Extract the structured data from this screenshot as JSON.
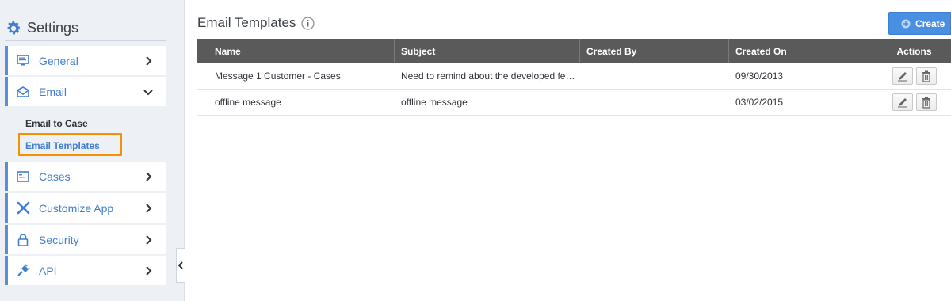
{
  "sidebar": {
    "title": "Settings",
    "items": [
      {
        "label": "General"
      },
      {
        "label": "Email"
      },
      {
        "label": "Cases"
      },
      {
        "label": "Customize App"
      },
      {
        "label": "Security"
      },
      {
        "label": "API"
      }
    ],
    "email_subitems": [
      {
        "label": "Email to Case"
      },
      {
        "label": "Email Templates"
      }
    ]
  },
  "main": {
    "title": "Email Templates",
    "create_label": "Create",
    "table": {
      "headers": [
        "Name",
        "Subject",
        "Created By",
        "Created On",
        "Actions"
      ],
      "rows": [
        {
          "name": "Message 1 Customer - Cases",
          "subject": "Need to remind about the developed fea…",
          "created_by": "",
          "created_on": "09/30/2013"
        },
        {
          "name": "offline message",
          "subject": "offline message",
          "created_by": "",
          "created_on": "03/02/2015"
        }
      ]
    }
  },
  "colors": {
    "accent": "#3f7ed0",
    "highlight": "#f39200",
    "header_bg": "#5a5a5a",
    "create_bg": "#4a90e2"
  }
}
